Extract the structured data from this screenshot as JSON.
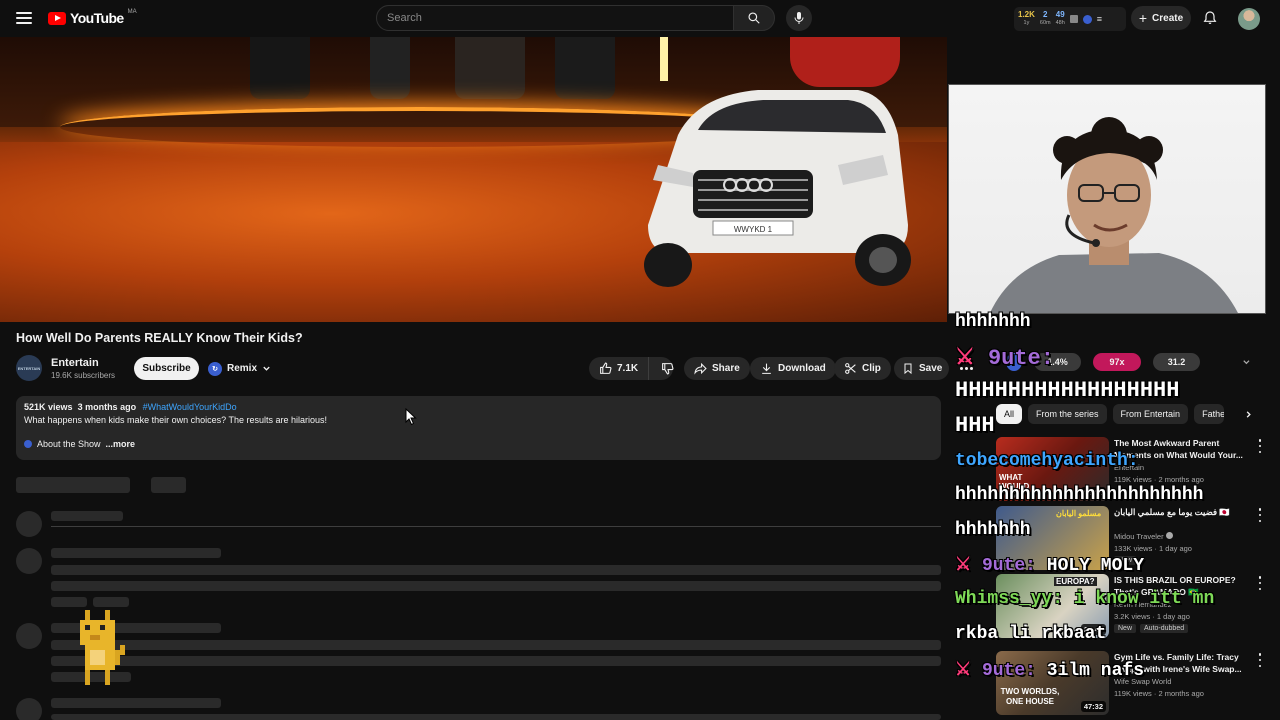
{
  "header": {
    "logo_text": "YouTube",
    "logo_region": "MA",
    "search_placeholder": "Search",
    "create_label": "Create",
    "extension_stats": [
      {
        "value": "1.2K",
        "label": "1y"
      },
      {
        "value": "2",
        "label": "60m"
      },
      {
        "value": "49",
        "label": "48h"
      }
    ]
  },
  "video": {
    "title": "How Well Do Parents REALLY Know Their Kids?",
    "car_plate": "WWYKD 1"
  },
  "channel": {
    "avatar_text": "ENTERTAIN",
    "name": "Entertain",
    "subscribers": "19.6K subscribers",
    "subscribe_label": "Subscribe",
    "remix_label": "Remix"
  },
  "actions": {
    "likes": "7.1K",
    "share": "Share",
    "download": "Download",
    "clip": "Clip",
    "save": "Save"
  },
  "description": {
    "views": "521K views",
    "age": "3 months ago",
    "hashtag": "#WhatWouldYourKidDo",
    "text": "What happens when kids make their own choices? The results are hilarious!",
    "about": "About the Show",
    "more": "...more"
  },
  "overlay_stats": [
    {
      "value": "1.4%",
      "color": "#3a3a3a"
    },
    {
      "value": "97x",
      "color": "#c2185b"
    },
    {
      "value": "31.2",
      "color": "#3a3a3a"
    }
  ],
  "chips": [
    "All",
    "From the series",
    "From Entertain",
    "Fathe"
  ],
  "recommendations": [
    {
      "title": "The Most Awkward Parent Moments on What Would Your...",
      "channel": "Entertain",
      "views": "119K views · 2 months ago",
      "duration": "19:25",
      "badges": [],
      "thumb_colors": [
        "#b82c1e",
        "#2b2b2b"
      ],
      "thumb_text": "WHAT WOULD YOUR"
    },
    {
      "title": "فضيت يوما مع مسلمي اليابان 🇯🇵",
      "channel": "Midou Traveler",
      "views": "133K views · 1 day ago",
      "duration": "",
      "badges": [
        "New"
      ],
      "thumb_colors": [
        "#3f5a8c",
        "#c9a24a"
      ],
      "thumb_text": "مسلمو اليابان"
    },
    {
      "title": "IS THIS BRAZIL OR EUROPE? That's GRAMADO 🇧🇷",
      "channel": "Kevin Hernandez",
      "views": "3.2K views · 1 day ago",
      "duration": "27:46",
      "badges": [
        "New",
        "Auto-dubbed"
      ],
      "thumb_colors": [
        "#6b8f5e",
        "#d9d3c2"
      ],
      "thumb_text": "EUROPA?"
    },
    {
      "title": "Gym Life vs. Family Life: Tracy Swaps with Irene's Wife Swap...",
      "channel": "Wife Swap World",
      "views": "119K views · 2 months ago",
      "duration": "47:32",
      "badges": [],
      "thumb_colors": [
        "#8a6a4a",
        "#2d2d2d"
      ],
      "thumb_text": "TWO WORLDS, ONE HOUSE"
    }
  ],
  "chat": [
    {
      "user": "",
      "text": "hhhhhhh",
      "color": "#ffffff",
      "size": 18
    },
    {
      "user": "9ute:",
      "text": "HHHHHHHHHHHHHHHHH",
      "color": "#ffffff",
      "size": 22
    },
    {
      "user": "",
      "text": "HHH",
      "color": "#ffffff",
      "size": 22
    },
    {
      "user": "",
      "text": "tobecomehyacinth:",
      "color": "#3ea6ff",
      "size": 18
    },
    {
      "user": "",
      "text": "hhhhhhhhhhhhhhhhhhhhhhh",
      "color": "#ffffff",
      "size": 18
    },
    {
      "user": "",
      "text": "hhhhhhh",
      "color": "#ffffff",
      "size": 18
    },
    {
      "user": "9ute:",
      "text": "HOLY MOLY",
      "color": "#ffffff",
      "size": 18
    },
    {
      "user": "",
      "text": "Whimss_yy: i know itt mn",
      "color": "#7ed957",
      "size": 18
    },
    {
      "user": "",
      "text": "rkba li rkbaat",
      "color": "#ffffff",
      "size": 18
    },
    {
      "user": "9ute:",
      "text": "3ilm nafs",
      "color": "#ffffff",
      "size": 18
    }
  ]
}
